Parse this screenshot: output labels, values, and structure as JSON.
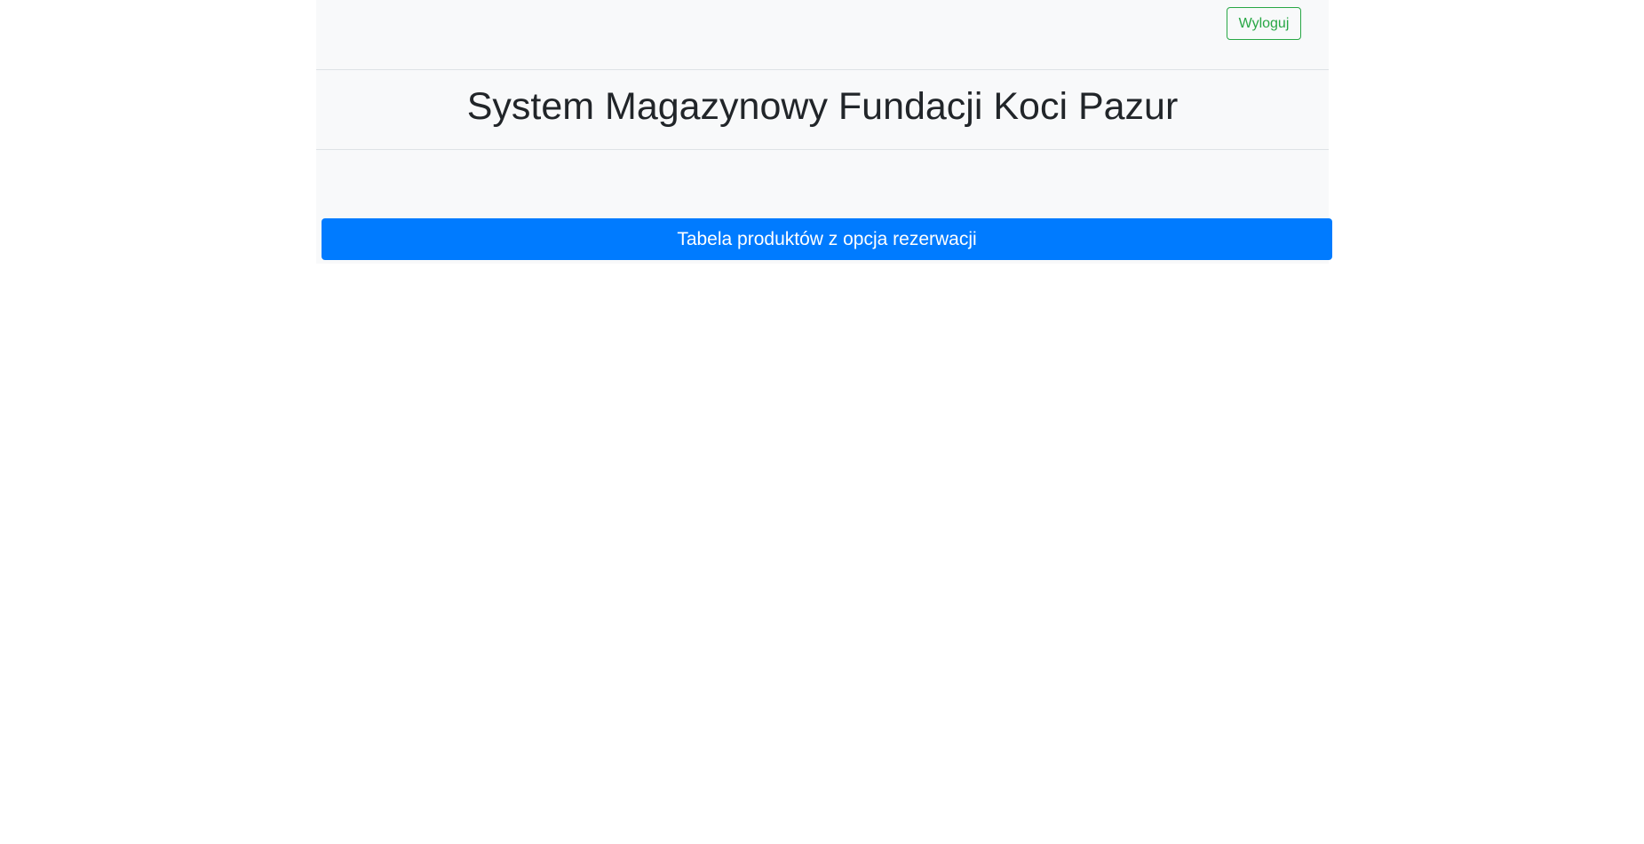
{
  "header": {
    "logout_label": "Wyloguj",
    "title": "System Magazynowy Fundacji Koci Pazur"
  },
  "main": {
    "products_table_button": "Tabela produktów z opcja rezerwacji"
  },
  "colors": {
    "primary": "#007bff",
    "success": "#28a745",
    "background": "#f8f9fa"
  }
}
